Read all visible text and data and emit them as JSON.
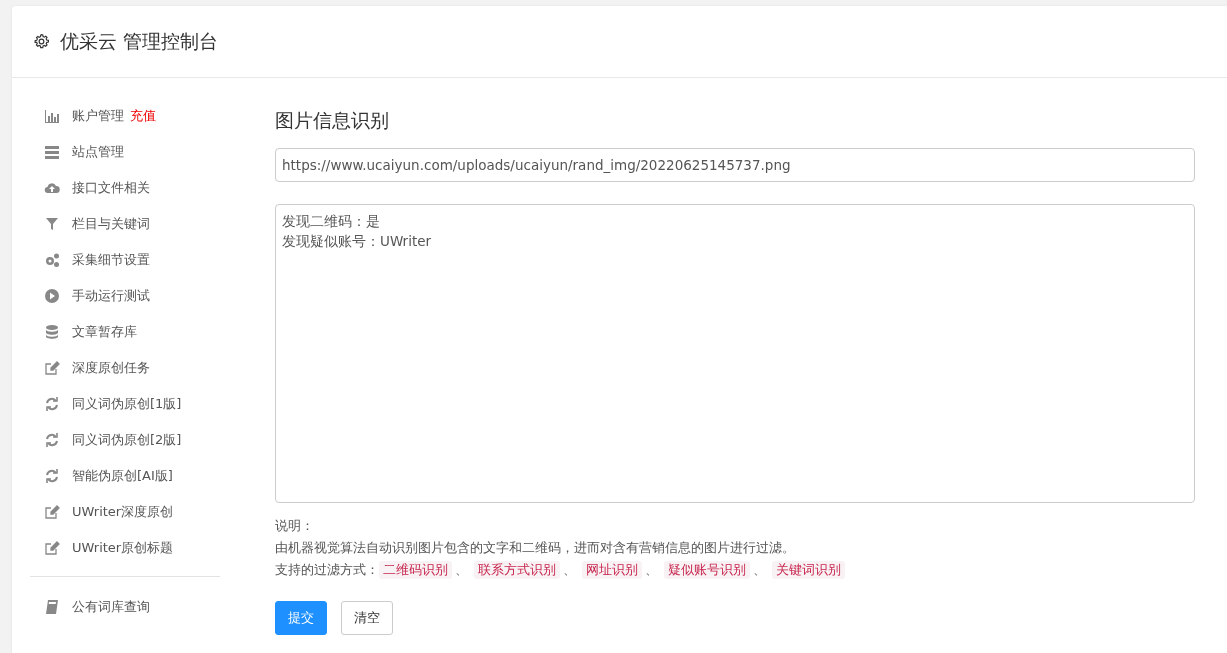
{
  "header": {
    "title": "优采云 管理控制台"
  },
  "sidebar": {
    "groups": [
      [
        {
          "kind": "chart",
          "label": "账户管理",
          "badge": "充值"
        },
        {
          "kind": "server",
          "label": "站点管理"
        },
        {
          "kind": "cloud",
          "label": "接口文件相关"
        },
        {
          "kind": "filter",
          "label": "栏目与关键词"
        },
        {
          "kind": "gears",
          "label": "采集细节设置"
        },
        {
          "kind": "play",
          "label": "手动运行测试"
        },
        {
          "kind": "database",
          "label": "文章暂存库"
        },
        {
          "kind": "edit",
          "label": "深度原创任务"
        },
        {
          "kind": "refresh",
          "label": "同义词伪原创[1版]"
        },
        {
          "kind": "refresh",
          "label": "同义词伪原创[2版]"
        },
        {
          "kind": "refresh",
          "label": "智能伪原创[AI版]"
        },
        {
          "kind": "edit",
          "label": "UWriter深度原创"
        },
        {
          "kind": "edit",
          "label": "UWriter原创标题"
        }
      ],
      [
        {
          "kind": "book",
          "label": "公有词库查询"
        }
      ]
    ]
  },
  "main": {
    "title": "图片信息识别",
    "url_field": {
      "value": "https://www.ucaiyun.com/uploads/ucaiyun/rand_img/20220625145737.png"
    },
    "result_box": {
      "lines": [
        "发现二维码：是",
        "发现疑似账号：UWriter"
      ]
    },
    "notes": {
      "heading": "说明：",
      "description": "由机器视觉算法自动识别图片包含的文字和二维码，进而对含有营销信息的图片进行过滤。",
      "methods_label": "支持的过滤方式：",
      "methods": [
        {
          "text": "二维码识别",
          "sep": "、"
        },
        {
          "text": "联系方式识别",
          "sep": "、"
        },
        {
          "text": "网址识别",
          "sep": "、"
        },
        {
          "text": "疑似账号识别",
          "sep": "、"
        },
        {
          "text": "关键词识别"
        }
      ]
    },
    "buttons": [
      {
        "kind": "primary",
        "label": "提交"
      },
      {
        "kind": "default",
        "label": "清空"
      }
    ]
  }
}
